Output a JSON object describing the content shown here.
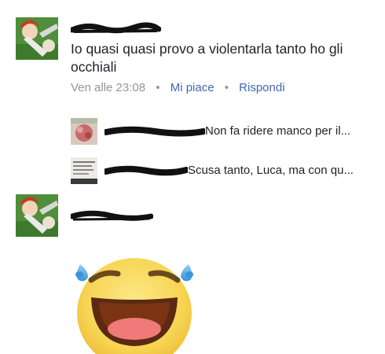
{
  "comment1": {
    "author_redacted": true,
    "text": "Io quasi quasi provo a violentarla tanto ho gli occhiali",
    "time": "Ven alle 23:08",
    "separator": "•",
    "like_label": "Mi piace",
    "reply_label": "Rispondi"
  },
  "replies": [
    {
      "text": "Non fa ridere manco per il..."
    },
    {
      "text": "Scusa tanto, Luca, ma con qu..."
    }
  ],
  "comment2": {
    "author_redacted": true,
    "content": "laughing-tears-emoji"
  },
  "colors": {
    "link": "#4267b2",
    "meta": "#90949c",
    "text": "#1d2129",
    "emoji_face": "#f7d553"
  }
}
